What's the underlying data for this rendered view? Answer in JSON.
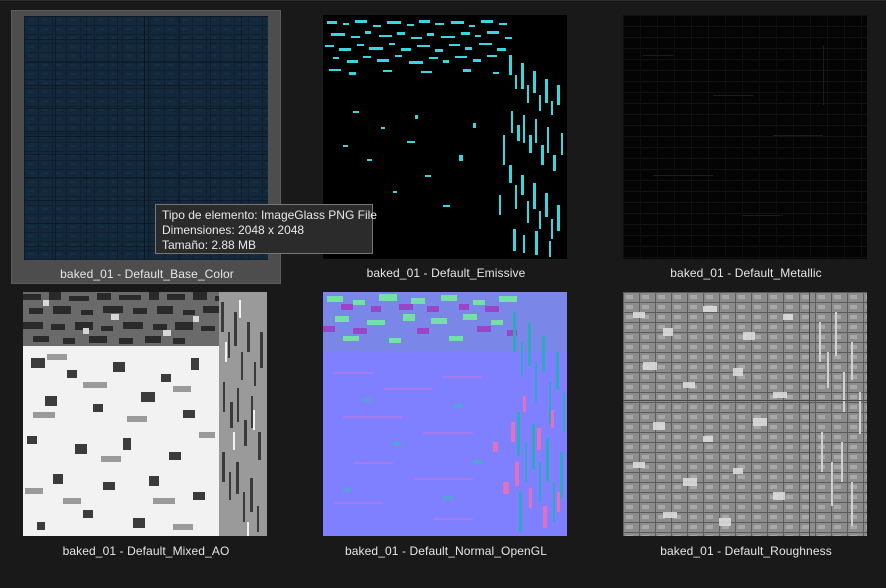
{
  "files": [
    {
      "name": "baked_01 - Default_Base_Color",
      "texture": "base-color-texture"
    },
    {
      "name": "baked_01 - Default_Emissive",
      "texture": "emissive-texture"
    },
    {
      "name": "baked_01 - Default_Metallic",
      "texture": "metallic-texture"
    },
    {
      "name": "baked_01 - Default_Mixed_AO",
      "texture": "mixed-ao-texture"
    },
    {
      "name": "baked_01 - Default_Normal_OpenGL",
      "texture": "normal-texture"
    },
    {
      "name": "baked_01 - Default_Roughness",
      "texture": "roughness-texture"
    }
  ],
  "tooltip": {
    "type_line": "Tipo de elemento: ImageGlass PNG File",
    "dimensions_line": "Dimensiones: 2048 x 2048",
    "size_line": "Tamaño: 2.88 MB"
  },
  "colors": {
    "background": "#191919",
    "selection": "#4d4d4d",
    "base_color": "#13273a",
    "emissive": "#38d7e0",
    "normal_base": "#7f7fff"
  }
}
